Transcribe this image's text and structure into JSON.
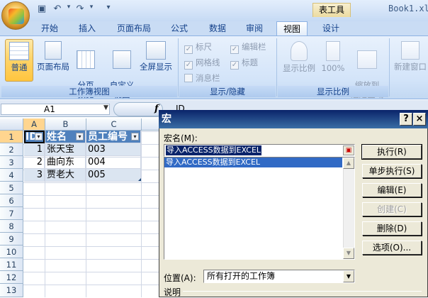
{
  "window": {
    "title": "Book1.xl",
    "context_tab": "表工具"
  },
  "tabs": [
    "开始",
    "插入",
    "页面布局",
    "公式",
    "数据",
    "审阅",
    "视图",
    "设计"
  ],
  "ribbon": {
    "workbook_views": {
      "title": "工作簿视图",
      "buttons": [
        "普通",
        "页面布局",
        "分页\n预览",
        "自定义\n视图",
        "全屏显示"
      ]
    },
    "show_hide": {
      "title": "显示/隐藏",
      "checks": [
        {
          "label": "标尺",
          "checked": true
        },
        {
          "label": "网格线",
          "checked": true
        },
        {
          "label": "消息栏",
          "checked": false
        },
        {
          "label": "编辑栏",
          "checked": true
        },
        {
          "label": "标题",
          "checked": true
        }
      ]
    },
    "zoom": {
      "title": "显示比例",
      "buttons": [
        "显示比例",
        "100%",
        "缩放到\n选定区域"
      ]
    },
    "window_group": {
      "buttons": [
        "新建窗口"
      ]
    }
  },
  "formula_bar": {
    "name_box": "A1",
    "fx": "f",
    "content": "ID"
  },
  "sheet": {
    "columns": [
      "A",
      "B",
      "C"
    ],
    "rows": [
      "1",
      "2",
      "3",
      "4",
      "5",
      "6",
      "7",
      "8",
      "9",
      "10",
      "11",
      "12",
      "13"
    ],
    "header": [
      "ID",
      "姓名",
      "员工编号"
    ],
    "data": [
      [
        "1",
        "张天宝",
        "003"
      ],
      [
        "2",
        "曲向东",
        "004"
      ],
      [
        "3",
        "贾老大",
        "005"
      ]
    ]
  },
  "dialog": {
    "title": "宏",
    "help": "?",
    "close": "×",
    "macro_name_label": "宏名(M):",
    "macro_name_value": "导入ACCESS数据到EXCEL",
    "macro_list": [
      "导入ACCESS数据到EXCEL"
    ],
    "buttons": [
      "执行(R)",
      "单步执行(S)",
      "编辑(E)",
      "创建(C)",
      "删除(D)",
      "选项(O)..."
    ],
    "location_label": "位置(A):",
    "location_value": "所有打开的工作簿",
    "description_label": "说明"
  }
}
